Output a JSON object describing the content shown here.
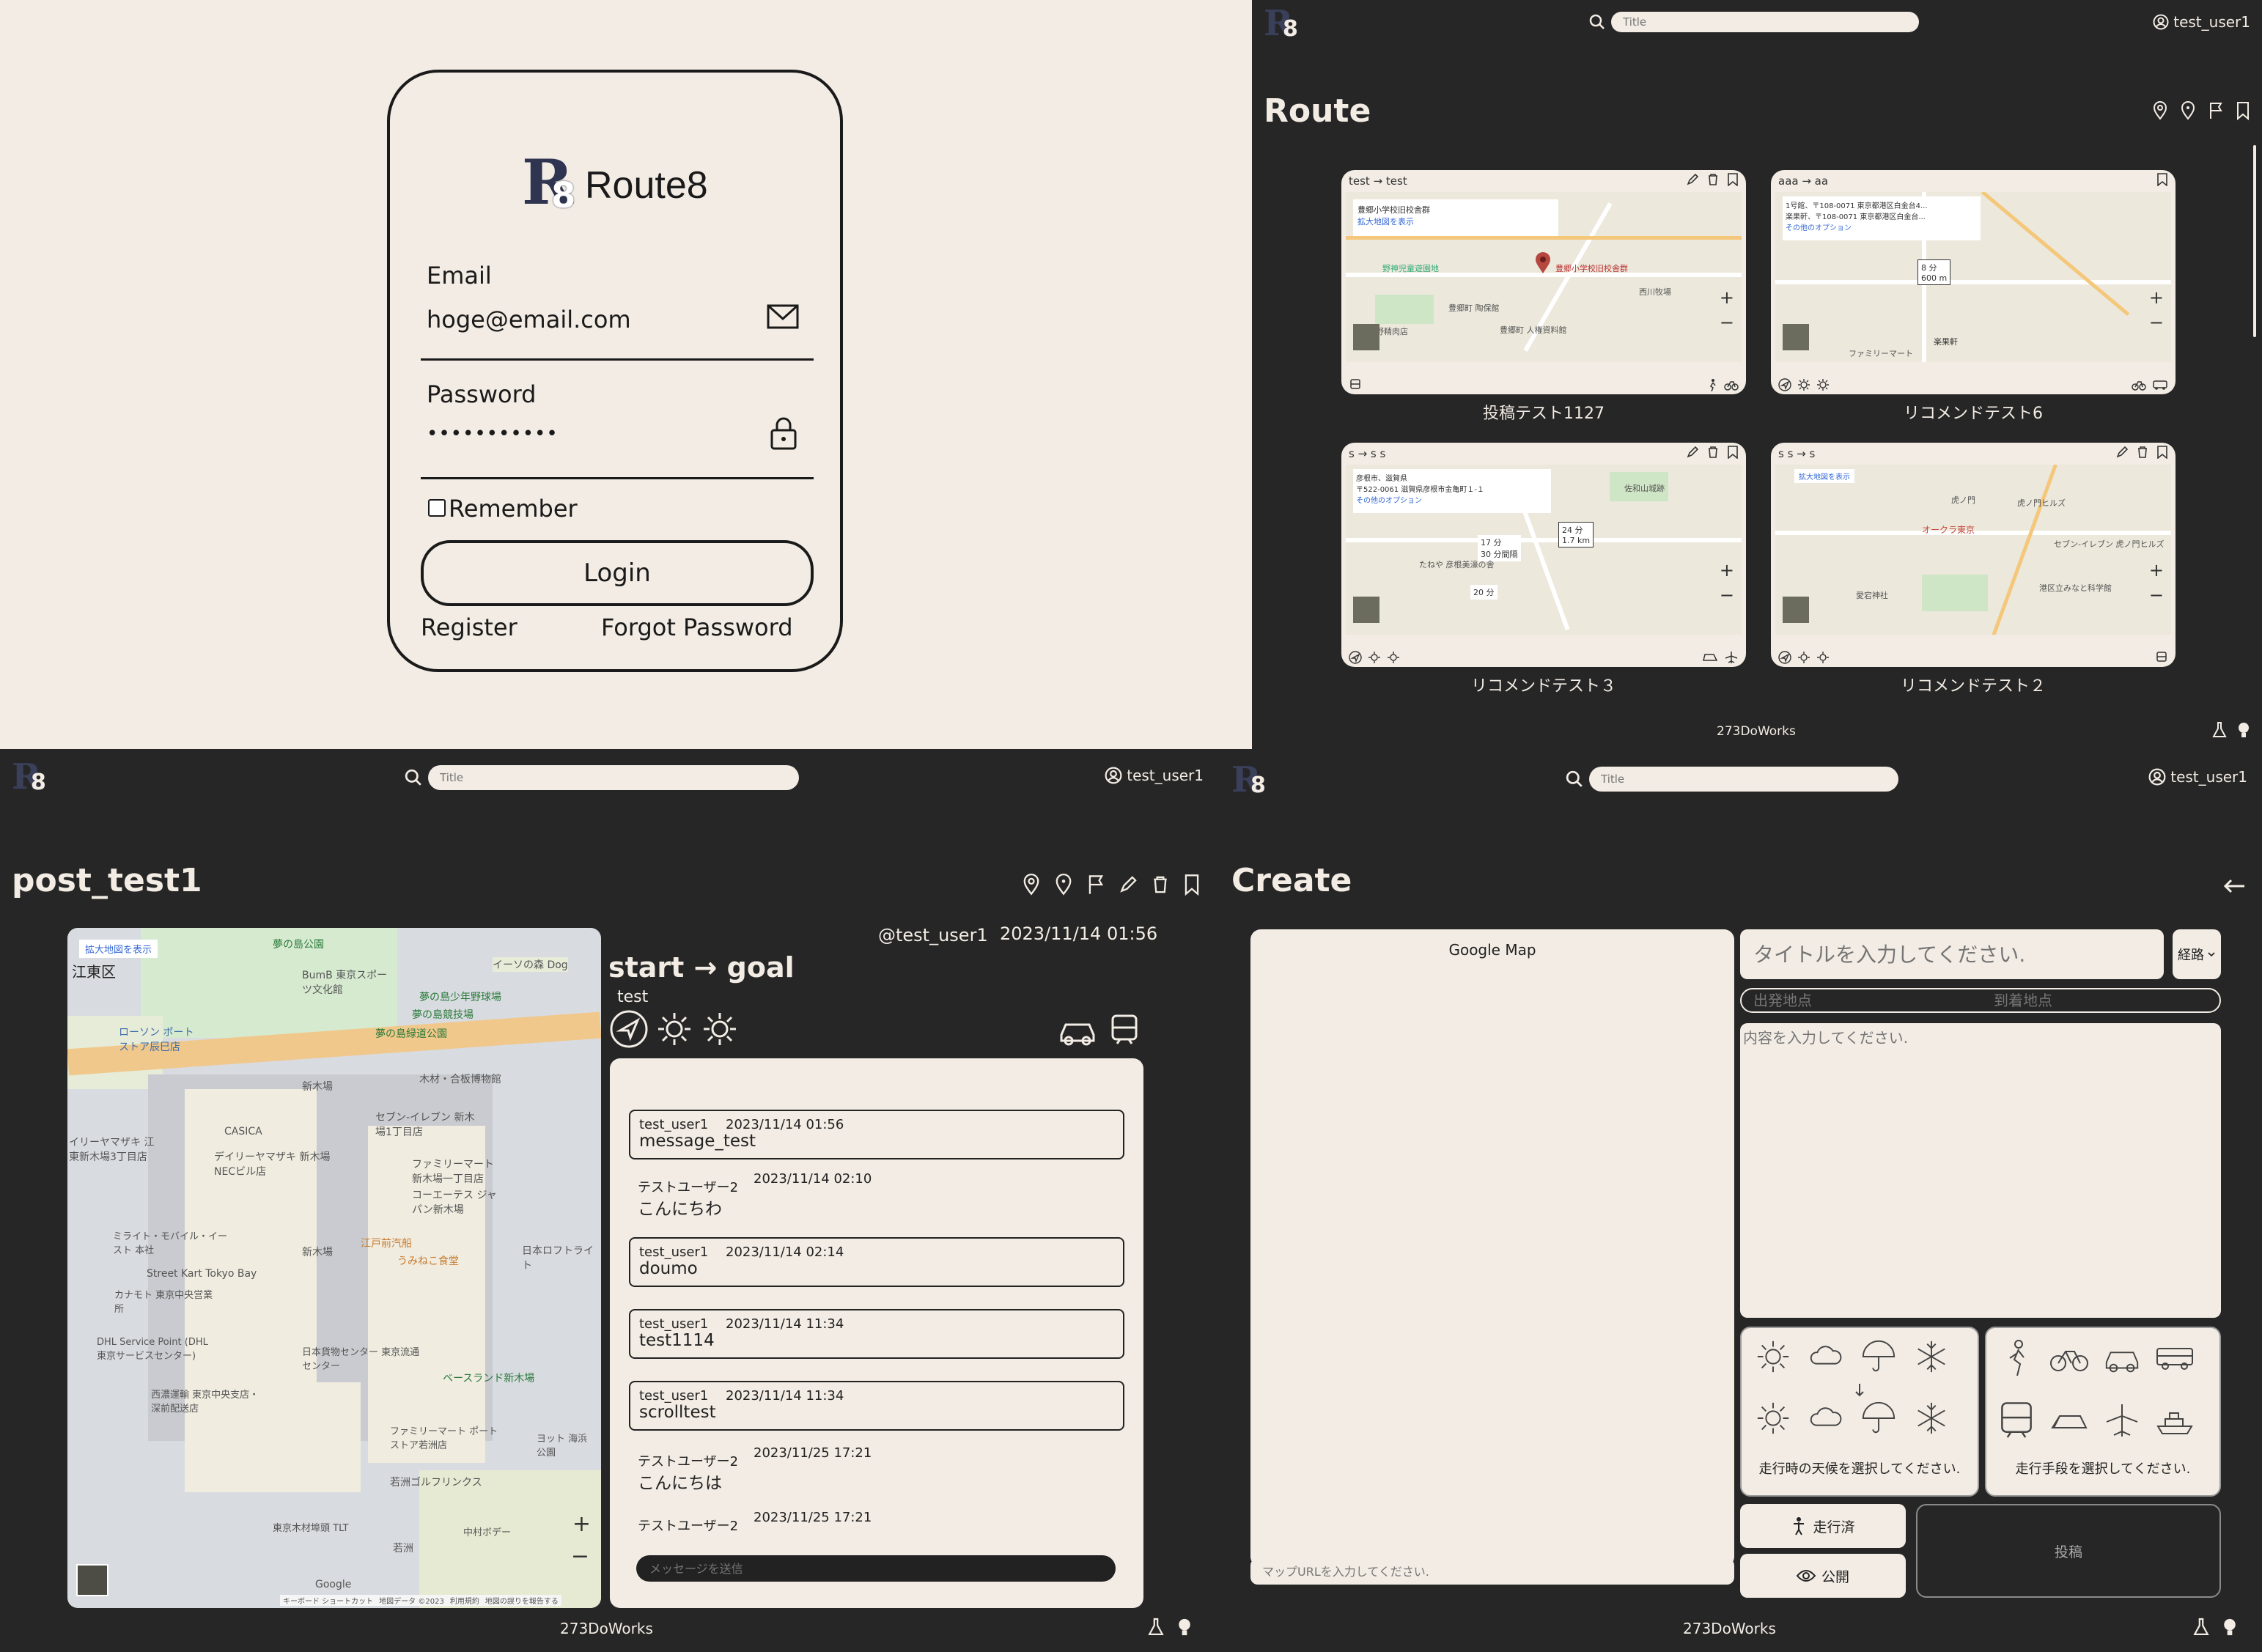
{
  "login": {
    "brand": "Route8",
    "logo_letter": "R",
    "logo_digit": "8",
    "email_label": "Email",
    "email_value": "hoge@email.com",
    "password_label": "Password",
    "password_value": "•••••••••••",
    "remember_label": "Remember",
    "login_button": "Login",
    "register_link": "Register",
    "forgot_link": "Forgot Password"
  },
  "route": {
    "search_placeholder": "Title",
    "user": "test_user1",
    "title": "Route",
    "footer": "273DoWorks",
    "cards": [
      {
        "header": "test → test",
        "caption": "投稿テスト1127",
        "map_labels": [
          "豊郷小学校旧校舎群",
          "拡大地図を表示",
          "野神児童遊園地",
          "豊郷町 陶保館",
          "豊郷町 人権資料館",
          "大野精肉店",
          "西川牧場",
          "豊郷小学校旧校舎群"
        ]
      },
      {
        "header": "aaa → aa",
        "caption": "リコメンドテスト6",
        "map_labels": [
          "1号館、〒108-0071 東京都港区白金台4...",
          "楽果軒、〒108-0071 東京都港区白金台...",
          "その他のオプション",
          "8 分",
          "600 m",
          "ファミリーマート",
          "楽果軒"
        ]
      },
      {
        "header": "s → s s",
        "caption": "リコメンドテスト３",
        "map_labels": [
          "彦根市、滋賀県",
          "〒522-0061 滋賀県彦根市金亀町１-１",
          "その他のオプション",
          "24 分",
          "1.7 km",
          "17 分",
          "30 分間隔",
          "20 分",
          "佐和山城跡",
          "たねや 彦根美濠の舎"
        ]
      },
      {
        "header": "s s → s",
        "caption": "リコメンドテスト２",
        "map_labels": [
          "拡大地図を表示",
          "虎ノ門ヒルズ",
          "オークラ東京",
          "セブン-イレブン 虎ノ門ヒルズ",
          "港区立みなと科学館",
          "虎ノ門",
          "愛宕神社"
        ]
      }
    ]
  },
  "post": {
    "search_placeholder": "Title",
    "user": "test_user1",
    "title": "post_test1",
    "footer": "273DoWorks",
    "author": "@test_user1",
    "datetime": "2023/11/14 01:56",
    "route": "start → goal",
    "description": "test",
    "map_labels": [
      "拡大地図を表示",
      "江東区",
      "夢の島公園",
      "BumB 東京スポーツ文化館",
      "夢の島競技場",
      "夢の島少年野球場",
      "夢の島緑道公園",
      "ローソン ポートストア辰巳店",
      "イーソの森 Dog",
      "新木場",
      "木材・合板博物館",
      "CASICA",
      "セブン-イレブン 新木場1丁目店",
      "デイリーヤマザキ 新木場NECビル店",
      "ファミリーマート 新木場一丁目店",
      "コーエーテス ジャパン新木場",
      "イリーヤマザキ 江東新木場3丁目店",
      "江戸前汽船",
      "うみねこ食堂",
      "日本ロフトライト",
      "Street Kart Tokyo Bay",
      "ミライト・モバイル・イースト 本社",
      "新木場",
      "カナモト 東京中央営業所",
      "DHL Service Point (DHL 東京サービスセンター)",
      "日本貨物センター 東京流通センター",
      "ベースランド新木場",
      "西濃運輸 東京中央支店・深前配送店",
      "ファミリーマート ポートストア若洲店",
      "ヨット 海浜公園",
      "若洲ゴルフリンクス",
      "東京木材埠頭 TLT",
      "若洲",
      "中村ボデー",
      "Google",
      "キーボード ショートカット",
      "地図データ ©2023",
      "利用規約",
      "地図の誤りを報告する"
    ],
    "messages": [
      {
        "user": "test_user1",
        "time": "2023/11/14 01:56",
        "body": "message_test",
        "boxed": true
      },
      {
        "user": "テストユーザー2",
        "time": "2023/11/14 02:10",
        "body": "こんにちわ",
        "boxed": false
      },
      {
        "user": "test_user1",
        "time": "2023/11/14 02:14",
        "body": "doumo",
        "boxed": true
      },
      {
        "user": "test_user1",
        "time": "2023/11/14 11:34",
        "body": "test1114",
        "boxed": true
      },
      {
        "user": "test_user1",
        "time": "2023/11/14 11:34",
        "body": "scrolltest",
        "boxed": true
      },
      {
        "user": "テストユーザー2",
        "time": "2023/11/25 17:21",
        "body": "こんにちは",
        "boxed": false
      },
      {
        "user": "テストユーザー2",
        "time": "2023/11/25 17:21",
        "body": "",
        "boxed": false
      }
    ],
    "message_placeholder": "メッセージを送信"
  },
  "create": {
    "search_placeholder": "Title",
    "user": "test_user1",
    "title": "Create",
    "footer": "273DoWorks",
    "map_placeholder": "Google Map",
    "title_placeholder": "タイトルを入力してください.",
    "kind_select": "経路",
    "start_placeholder": "出発地点",
    "goal_placeholder": "到着地点",
    "content_placeholder": "内容を入力してください.",
    "weather_hint": "走行時の天候を選択してください.",
    "transport_hint": "走行手段を選択してください.",
    "done_button": "走行済",
    "public_button": "公開",
    "submit_button": "投稿",
    "map_url_placeholder": "マップURLを入力してください."
  }
}
